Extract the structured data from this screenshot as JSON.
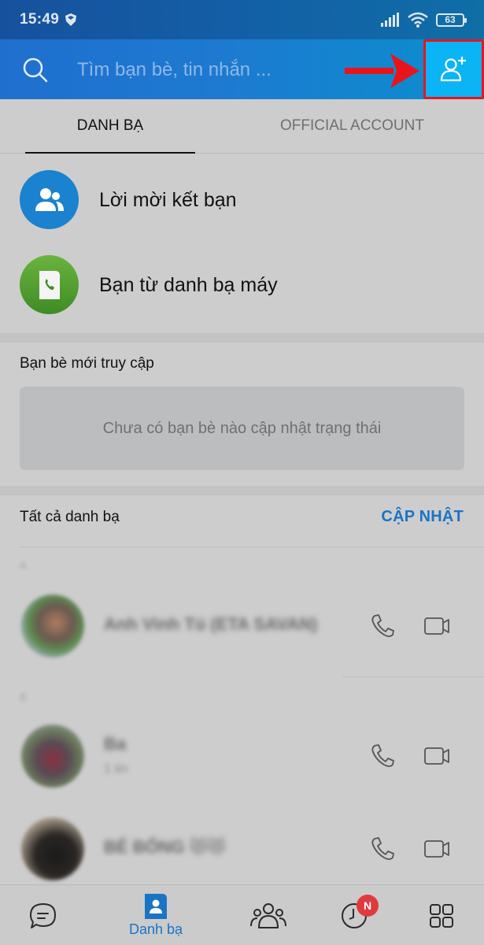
{
  "status_bar": {
    "time": "15:49",
    "battery": "63"
  },
  "header": {
    "search_placeholder": "Tìm bạn bè, tin nhắn ...",
    "add_friend_icon": "add-user-icon",
    "annotation": "red-arrow pointing to add friend button"
  },
  "tabs": [
    {
      "label": "DANH BẠ",
      "active": true
    },
    {
      "label": "OFFICIAL ACCOUNT",
      "active": false
    }
  ],
  "actions": [
    {
      "label": "Lời mời kết bạn",
      "icon": "friends-icon",
      "color": "#1a82cf"
    },
    {
      "label": "Bạn từ danh bạ máy",
      "icon": "phonebook-icon",
      "color": "#4a9a2c"
    }
  ],
  "recent": {
    "title": "Bạn bè mới truy cập",
    "empty_text": "Chưa có bạn bè nào cập nhật trạng thái"
  },
  "all_contacts": {
    "title": "Tất cả danh bạ",
    "update_label": "CẬP NHẬT",
    "groups": [
      {
        "letter": "A",
        "contacts": [
          {
            "name": "Anh Vinh Tú (ETA SAVAN)",
            "sub": ""
          }
        ]
      },
      {
        "letter": "B",
        "contacts": [
          {
            "name": "Ba",
            "sub": "1 tin"
          },
          {
            "name": "BÉ BỐNG 😻😻",
            "sub": ""
          }
        ]
      }
    ]
  },
  "bottom_nav": [
    {
      "name": "messages",
      "label": ""
    },
    {
      "name": "contacts",
      "label": "Danh bạ",
      "active": true
    },
    {
      "name": "groups",
      "label": ""
    },
    {
      "name": "timeline",
      "label": "",
      "badge": "N"
    },
    {
      "name": "more",
      "label": ""
    }
  ],
  "colors": {
    "accent": "#1a74c4",
    "header_start": "#1f6fcf",
    "add_button": "#0bb4f4",
    "highlight": "#e8141c",
    "badge": "#df3b3e"
  }
}
